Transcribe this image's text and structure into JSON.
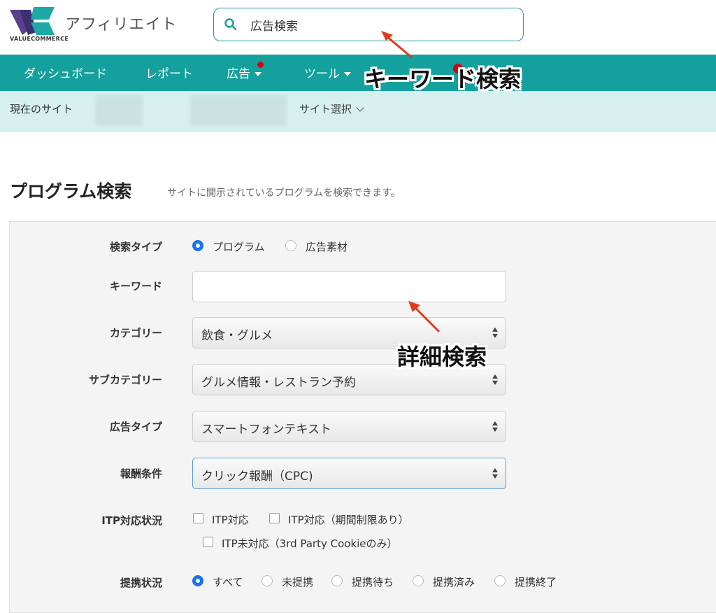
{
  "header": {
    "logo_text": "VALUECOMMERCE",
    "app_title": "アフィリエイト",
    "search_value": "広告検索"
  },
  "nav": {
    "items": [
      {
        "label": "ダッシュボード"
      },
      {
        "label": "レポート"
      },
      {
        "label": "広告"
      },
      {
        "label": "ツール"
      }
    ]
  },
  "site_bar": {
    "current_site_label": "現在のサイト",
    "site_select_label": "サイト選択"
  },
  "page": {
    "title": "プログラム検索",
    "description": "サイトに開示されているプログラムを検索できます。"
  },
  "form": {
    "search_type": {
      "label": "検索タイプ",
      "options": [
        "プログラム",
        "広告素材"
      ],
      "selected": "プログラム"
    },
    "keyword": {
      "label": "キーワード",
      "value": ""
    },
    "category": {
      "label": "カテゴリー",
      "value": "飲食・グルメ"
    },
    "subcategory": {
      "label": "サブカテゴリー",
      "value": "グルメ情報・レストラン予約"
    },
    "ad_type": {
      "label": "広告タイプ",
      "value": "スマートフォンテキスト"
    },
    "reward": {
      "label": "報酬条件",
      "value": "クリック報酬（CPC)"
    },
    "itp": {
      "label": "ITP対応状況",
      "options": [
        "ITP対応",
        "ITP対応（期間制限あり）",
        "ITP未対応（3rd Party Cookieのみ）"
      ]
    },
    "partnership": {
      "label": "提携状況",
      "options": [
        "すべて",
        "未提携",
        "提携待ち",
        "提携済み",
        "提携終了"
      ],
      "selected": "すべて"
    }
  },
  "annotations": {
    "keyword_search": "キーワード検索",
    "detail_search": "詳細検索"
  },
  "colors": {
    "nav_bg": "#14a19d",
    "site_bar_bg": "#d6f0f0",
    "radio_on": "#1a73e8",
    "arrow": "#e03a1e"
  }
}
